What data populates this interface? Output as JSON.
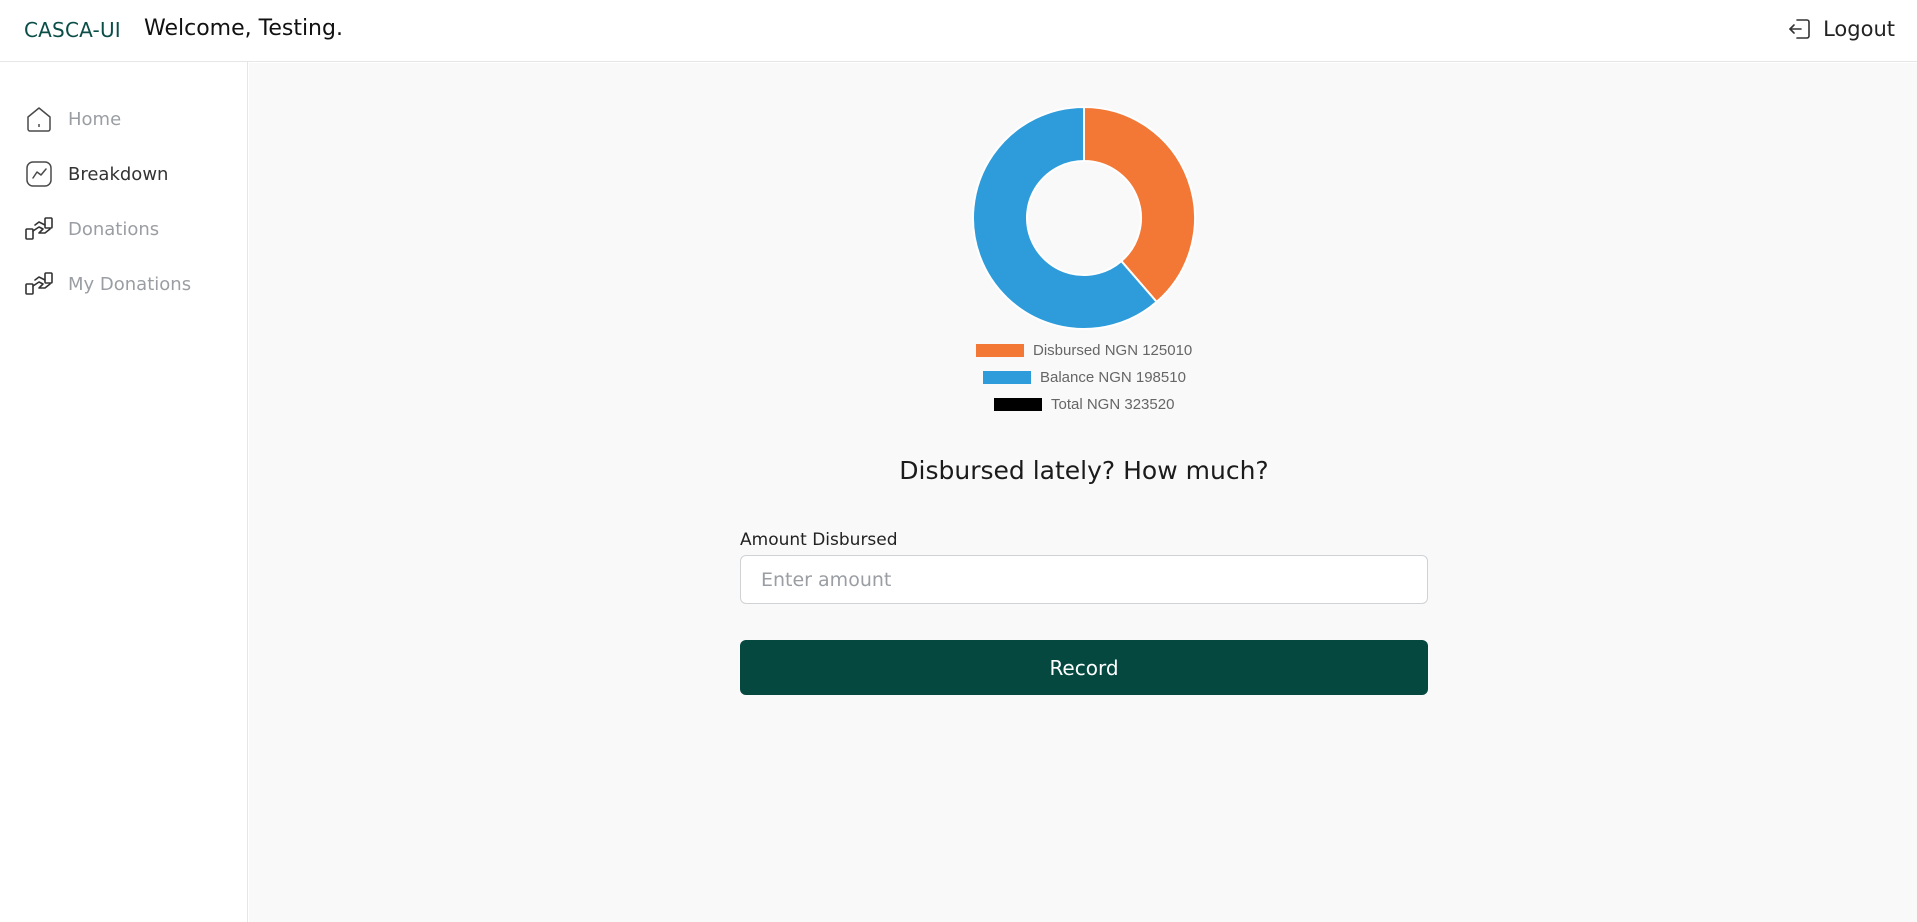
{
  "header": {
    "brand": "CASCA-UI",
    "welcome": "Welcome, Testing.",
    "logout_label": "Logout"
  },
  "sidebar": {
    "items": [
      {
        "label": "Home",
        "icon": "home-icon"
      },
      {
        "label": "Breakdown",
        "icon": "chart-icon",
        "active": true
      },
      {
        "label": "Donations",
        "icon": "handshake-icon"
      },
      {
        "label": "My Donations",
        "icon": "handshake-icon"
      }
    ]
  },
  "chart_data": {
    "type": "pie",
    "labels": [
      "Disbursed",
      "Balance"
    ],
    "values": [
      125010,
      198510
    ],
    "colors": [
      "#f37735",
      "#2e9cdb"
    ],
    "legend": [
      {
        "text": "Disbursed NGN 125010",
        "color": "#f37735"
      },
      {
        "text": "Balance NGN 198510",
        "color": "#2e9cdb"
      },
      {
        "text": "Total NGN 323520",
        "color": "#000000"
      }
    ]
  },
  "form": {
    "question": "Disbursed lately? How much?",
    "amount_label": "Amount Disbursed",
    "amount_placeholder": "Enter amount",
    "amount_value": "",
    "record_label": "Record"
  }
}
